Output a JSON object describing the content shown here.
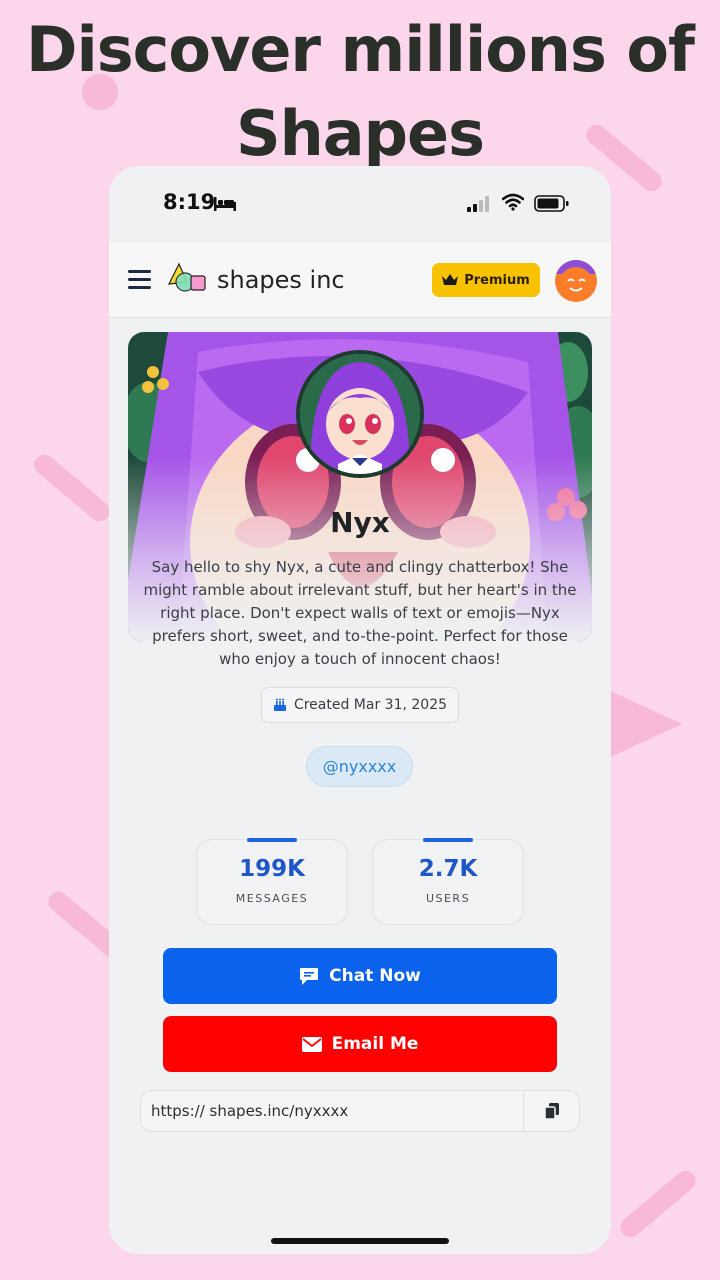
{
  "headline": "Discover millions of Shapes",
  "status_bar": {
    "time": "8:19"
  },
  "app_bar": {
    "brand": "shapes inc",
    "premium_label": "Premium"
  },
  "profile": {
    "name": "Nyx",
    "description": "Say hello to shy Nyx, a cute and clingy chatterbox! She might ramble about irrelevant stuff, but her heart's in the right place. Don't expect walls of text or emojis—Nyx prefers short, sweet, and to-the-point. Perfect for those who enjoy a touch of innocent chaos!",
    "created": "Created Mar 31, 2025",
    "handle": "@nyxxxx"
  },
  "stats": [
    {
      "value": "199K",
      "label": "MESSAGES"
    },
    {
      "value": "2.7K",
      "label": "USERS"
    }
  ],
  "actions": {
    "chat_label": "Chat Now",
    "email_label": "Email Me"
  },
  "share": {
    "url": "https:// shapes.inc/nyxxxx"
  },
  "colors": {
    "premium": "#f9c200",
    "chat": "#0b62ec",
    "email": "#fe0000",
    "accent": "#1e56c8",
    "background": "#fcd6ea"
  }
}
